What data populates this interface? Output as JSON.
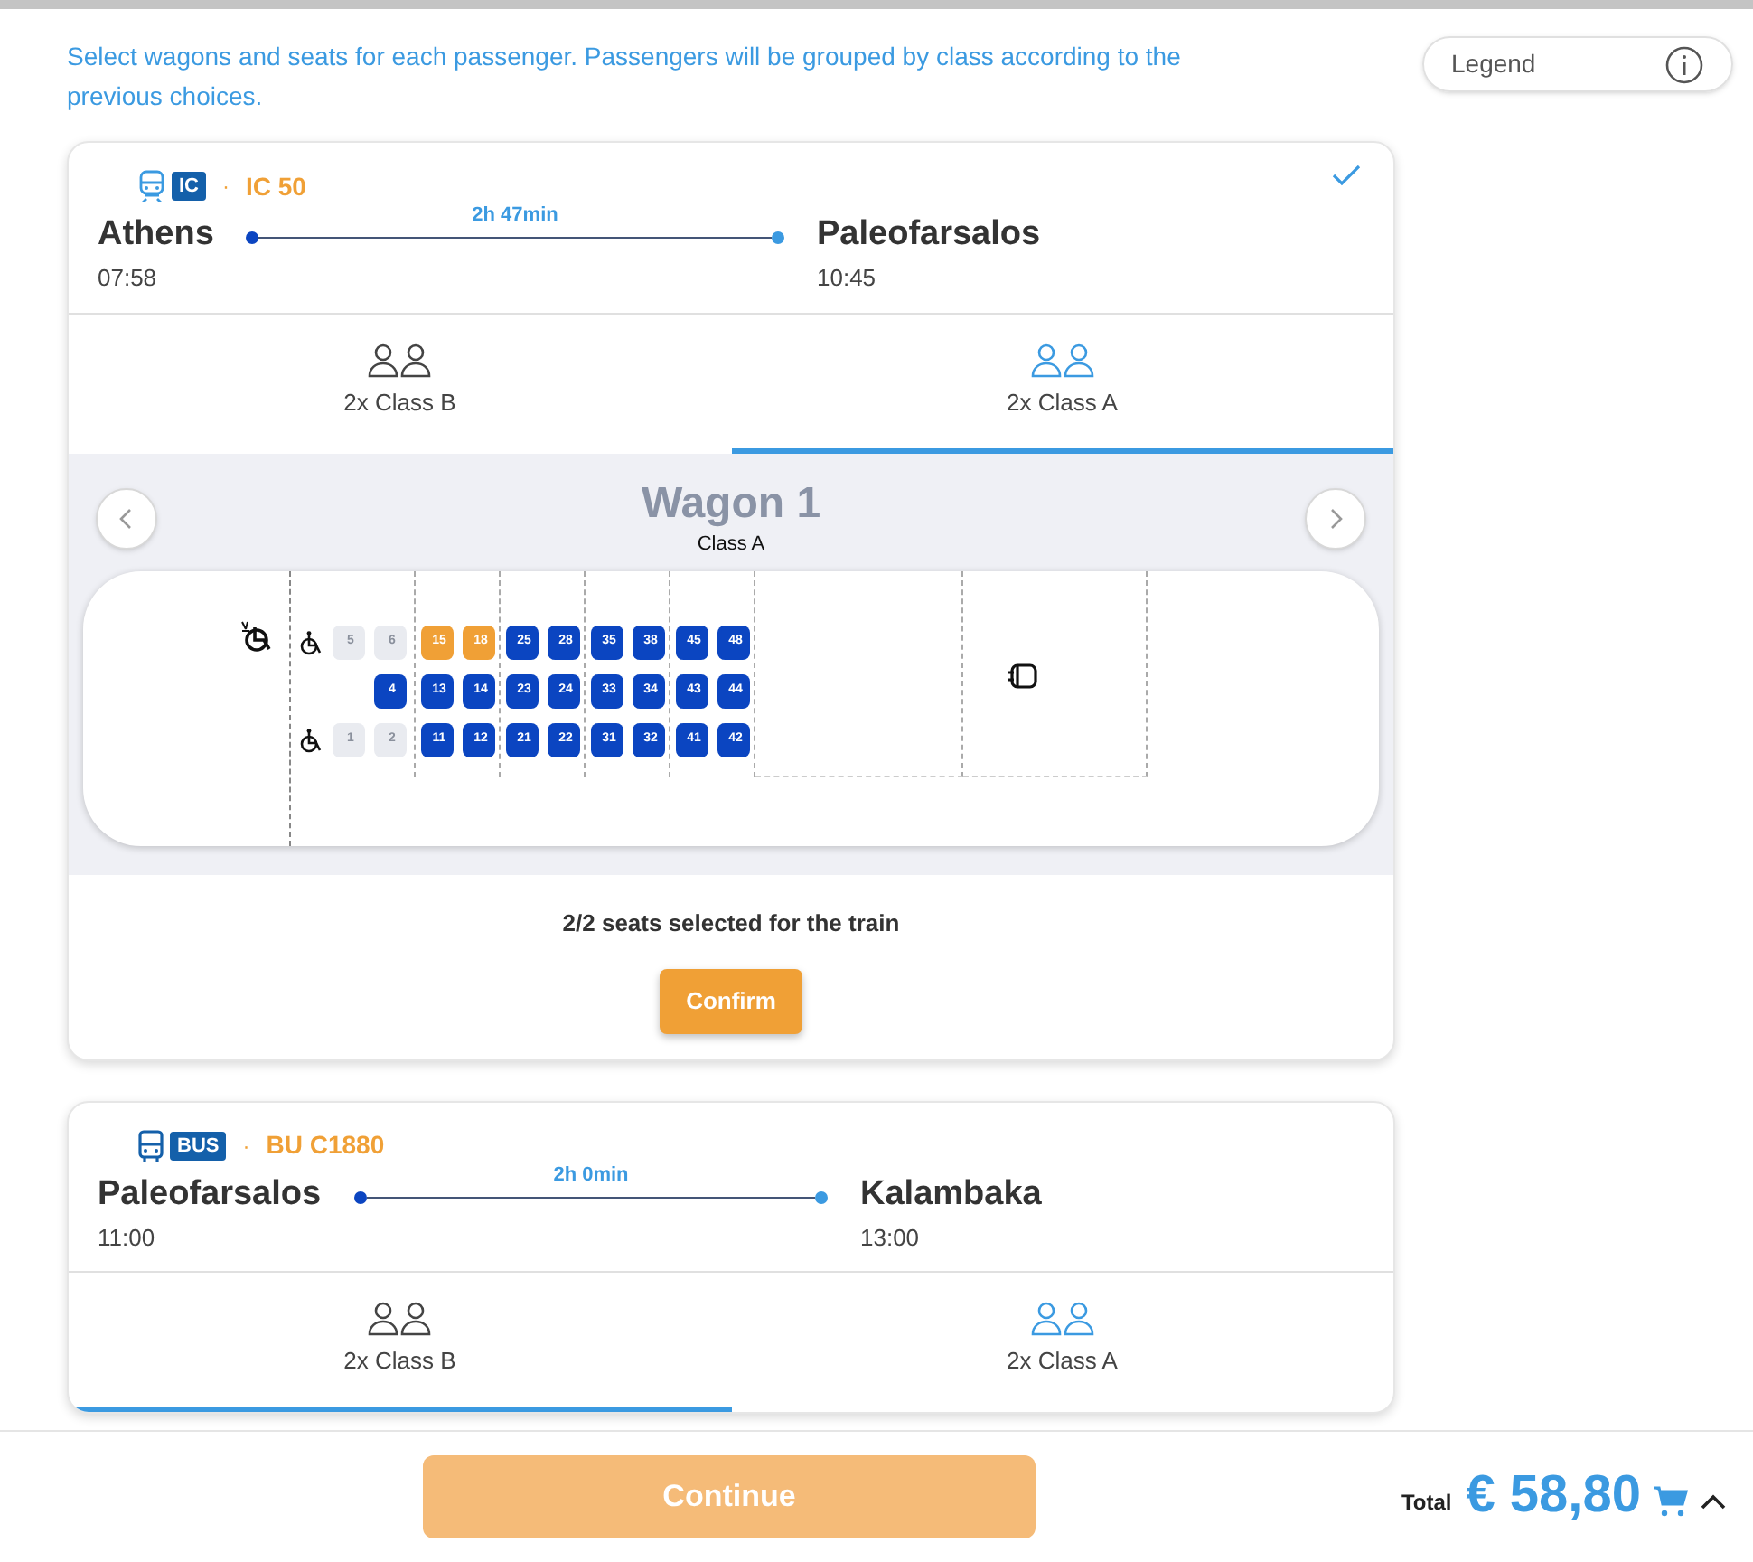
{
  "intro": "Select wagons and seats for each passenger. Passengers will be grouped by class according to the previous choices.",
  "legend": {
    "label": "Legend"
  },
  "segments": [
    {
      "kind": "train",
      "badge": "IC",
      "separator": "·",
      "code": "IC 50",
      "done": true,
      "from": "Athens",
      "dep": "07:58",
      "to": "Paleofarsalos",
      "arr": "10:45",
      "duration": "2h 47min",
      "tabs": [
        {
          "label": "2x Class B",
          "selected": false,
          "color": "#444444"
        },
        {
          "label": "2x Class A",
          "selected": true,
          "color": "#3b9ae1"
        }
      ],
      "wagon": {
        "title": "Wagon 1",
        "class": "Class A",
        "rows": [
          {
            "wheelchair": true,
            "seats": [
              {
                "number": "5",
                "kind": "unavailable"
              },
              {
                "number": "6",
                "kind": "unavailable"
              },
              {
                "number": "15",
                "kind": "selected"
              },
              {
                "number": "18",
                "kind": "selected"
              },
              {
                "number": "25",
                "kind": "free"
              },
              {
                "number": "28",
                "kind": "free"
              },
              {
                "number": "35",
                "kind": "free"
              },
              {
                "number": "38",
                "kind": "free"
              },
              {
                "number": "45",
                "kind": "free"
              },
              {
                "number": "48",
                "kind": "free"
              }
            ]
          },
          {
            "wheelchair": false,
            "seats": [
              {
                "number": "4",
                "kind": "free"
              },
              {
                "number": "13",
                "kind": "free"
              },
              {
                "number": "14",
                "kind": "free"
              },
              {
                "number": "23",
                "kind": "free"
              },
              {
                "number": "24",
                "kind": "free"
              },
              {
                "number": "33",
                "kind": "free"
              },
              {
                "number": "34",
                "kind": "free"
              },
              {
                "number": "43",
                "kind": "free"
              },
              {
                "number": "44",
                "kind": "free"
              }
            ]
          },
          {
            "wheelchair": true,
            "seats": [
              {
                "number": "1",
                "kind": "unavailable"
              },
              {
                "number": "2",
                "kind": "unavailable"
              },
              {
                "number": "11",
                "kind": "free"
              },
              {
                "number": "12",
                "kind": "free"
              },
              {
                "number": "21",
                "kind": "free"
              },
              {
                "number": "22",
                "kind": "free"
              },
              {
                "number": "31",
                "kind": "free"
              },
              {
                "number": "32",
                "kind": "free"
              },
              {
                "number": "41",
                "kind": "free"
              },
              {
                "number": "42",
                "kind": "free"
              }
            ]
          }
        ]
      },
      "status": "2/2 seats selected for the train",
      "confirm": "Confirm"
    },
    {
      "kind": "bus",
      "badge": "BUS",
      "separator": "·",
      "code": "BU C1880",
      "done": false,
      "from": "Paleofarsalos",
      "dep": "11:00",
      "to": "Kalambaka",
      "arr": "13:00",
      "duration": "2h 0min",
      "tabs": [
        {
          "label": "2x Class B",
          "selected": true,
          "color": "#444444"
        },
        {
          "label": "2x Class A",
          "selected": false,
          "color": "#3b9ae1"
        }
      ]
    }
  ],
  "footer": {
    "continue": "Continue",
    "continue_disabled": true,
    "total_label": "Total",
    "total": "€ 58,80"
  }
}
